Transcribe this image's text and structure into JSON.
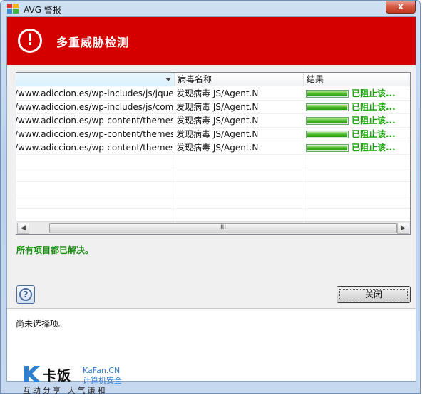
{
  "window": {
    "title": "AVG 警报",
    "close_glyph": "x"
  },
  "header": {
    "icon": "exclamation-icon",
    "icon_glyph": "!",
    "title": "多重威胁检测",
    "color": "#d40000"
  },
  "table": {
    "columns": [
      "",
      "病毒名称",
      "结果"
    ],
    "rows": [
      {
        "path": "/www.adiccion.es/wp-includes/js/jquer...",
        "threat": "发现病毒 JS/Agent.N",
        "progress": 1.0,
        "result": "已阻止该..."
      },
      {
        "path": "/www.adiccion.es/wp-includes/js/com...",
        "threat": "发现病毒 JS/Agent.N",
        "progress": 1.0,
        "result": "已阻止该..."
      },
      {
        "path": "/www.adiccion.es/wp-content/themes...",
        "threat": "发现病毒 JS/Agent.N",
        "progress": 1.0,
        "result": "已阻止该..."
      },
      {
        "path": "/www.adiccion.es/wp-content/themes...",
        "threat": "发现病毒 JS/Agent.N",
        "progress": 1.0,
        "result": "已阻止该..."
      },
      {
        "path": "/www.adiccion.es/wp-content/themes...",
        "threat": "发现病毒 JS/Agent.N",
        "progress": 1.0,
        "result": "已阻止该..."
      }
    ],
    "scroll": {
      "left_glyph": "◀",
      "right_glyph": "▶",
      "thumb_glyph": "III"
    }
  },
  "status": {
    "text": "所有项目都已解决。",
    "color": "#1a8a12"
  },
  "buttons": {
    "help_glyph": "?",
    "close_label": "关闭"
  },
  "info": {
    "text": "尚未选择项。"
  },
  "watermark": {
    "name": "卡饭",
    "site": "KaFan.CN",
    "tagline": "计算机安全",
    "slogan": "互助分享 大气谦和"
  }
}
